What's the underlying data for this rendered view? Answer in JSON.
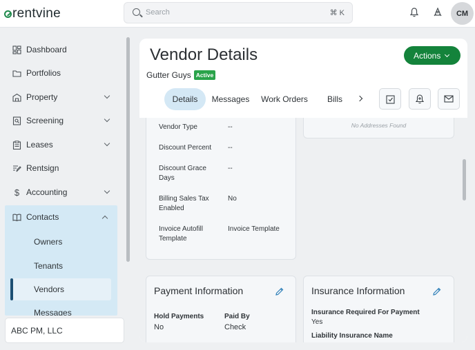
{
  "app": {
    "brand": "rentvine",
    "user_initials": "CM"
  },
  "search": {
    "placeholder": "Search",
    "shortcut": "⌘ K"
  },
  "sidebar": {
    "items": [
      {
        "label": "Dashboard",
        "icon": "dashboard-icon"
      },
      {
        "label": "Portfolios",
        "icon": "folder-icon"
      },
      {
        "label": "Property",
        "icon": "building-icon"
      },
      {
        "label": "Screening",
        "icon": "screening-icon"
      },
      {
        "label": "Leases",
        "icon": "clipboard-icon"
      },
      {
        "label": "Rentsign",
        "icon": "signature-icon"
      },
      {
        "label": "Accounting",
        "icon": "dollar-icon"
      }
    ],
    "contacts": {
      "label": "Contacts",
      "icon": "book-icon",
      "sub_items": [
        "Owners",
        "Tenants",
        "Vendors",
        "Messages"
      ],
      "active": "Vendors"
    },
    "organization": "ABC PM, LLC"
  },
  "page": {
    "title": "Vendor Details",
    "actions_label": "Actions",
    "vendor_name": "Gutter Guys",
    "status": "Active",
    "tabs": [
      "Details",
      "Messages",
      "Work Orders",
      "Bills"
    ],
    "active_tab": "Details"
  },
  "details": [
    {
      "label": "Vendor Type",
      "value": "--"
    },
    {
      "label": "Discount Percent",
      "value": "--"
    },
    {
      "label": "Discount Grace Days",
      "value": "--"
    },
    {
      "label": "Billing Sales Tax Enabled",
      "value": "No"
    },
    {
      "label": "Invoice Autofill Template",
      "value": "Invoice Template"
    }
  ],
  "addresses": {
    "empty_text": "No Addresses Found"
  },
  "payment": {
    "title": "Payment Information",
    "hold_label": "Hold Payments",
    "hold_value": "No",
    "paid_by_label": "Paid By",
    "paid_by_value": "Check"
  },
  "insurance": {
    "title": "Insurance Information",
    "required_label": "Insurance Required For Payment",
    "required_value": "Yes",
    "liability_label": "Liability Insurance Name"
  },
  "colors": {
    "primary": "#14833b",
    "active_badge": "#2aa34a",
    "nav_active_bg": "#d4e9f5",
    "tab_active_bg": "#d4e8f5"
  }
}
